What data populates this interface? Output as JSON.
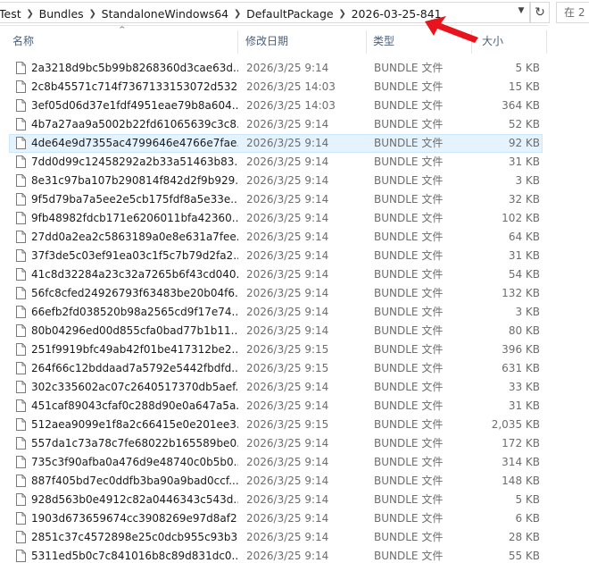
{
  "address": {
    "crumbs": [
      "Test",
      "Bundles",
      "StandaloneWindows64",
      "DefaultPackage",
      "2026-03-25-841"
    ],
    "search_placeholder": "在 2"
  },
  "columns": {
    "name": "名称",
    "date": "修改日期",
    "type": "类型",
    "size": "大小"
  },
  "files": [
    {
      "name": "2a3218d9bc5b99b8268360d3cae63d...",
      "date": "2026/3/25 9:14",
      "type": "BUNDLE 文件",
      "size": "5 KB"
    },
    {
      "name": "2c8b45571c714f7367133153072d532...",
      "date": "2026/3/25 14:03",
      "type": "BUNDLE 文件",
      "size": "15 KB"
    },
    {
      "name": "3ef05d06d37e1fdf4951eae79b8a604...",
      "date": "2026/3/25 14:03",
      "type": "BUNDLE 文件",
      "size": "364 KB"
    },
    {
      "name": "4b7a27aa9a5002b22fd61065639c3c8...",
      "date": "2026/3/25 9:14",
      "type": "BUNDLE 文件",
      "size": "52 KB"
    },
    {
      "name": "4de64e9d7355ac4799646e4766e7fae...",
      "date": "2026/3/25 9:14",
      "type": "BUNDLE 文件",
      "size": "92 KB"
    },
    {
      "name": "7dd0d99c12458292a2b33a51463b83...",
      "date": "2026/3/25 9:14",
      "type": "BUNDLE 文件",
      "size": "31 KB"
    },
    {
      "name": "8e31c97ba107b290814f842d2f9b929...",
      "date": "2026/3/25 9:14",
      "type": "BUNDLE 文件",
      "size": "3 KB"
    },
    {
      "name": "9f5d79ba7a5ee2e5cb175fdf8a5e33e...",
      "date": "2026/3/25 9:14",
      "type": "BUNDLE 文件",
      "size": "32 KB"
    },
    {
      "name": "9fb48982fdcb171e6206011bfa42360...",
      "date": "2026/3/25 9:14",
      "type": "BUNDLE 文件",
      "size": "102 KB"
    },
    {
      "name": "27dd0a2ea2c5863189a0e8e631a7fee...",
      "date": "2026/3/25 9:14",
      "type": "BUNDLE 文件",
      "size": "64 KB"
    },
    {
      "name": "37f3de5c03ef91ea03c1f5c7b79d2fa2...",
      "date": "2026/3/25 9:14",
      "type": "BUNDLE 文件",
      "size": "31 KB"
    },
    {
      "name": "41c8d32284a23c32a7265b6f43cd040...",
      "date": "2026/3/25 9:14",
      "type": "BUNDLE 文件",
      "size": "54 KB"
    },
    {
      "name": "56fc8cfed24926793f63483be20b04f6...",
      "date": "2026/3/25 9:14",
      "type": "BUNDLE 文件",
      "size": "132 KB"
    },
    {
      "name": "66efb2fd038520b98a2565cd9f17e74...",
      "date": "2026/3/25 9:14",
      "type": "BUNDLE 文件",
      "size": "3 KB"
    },
    {
      "name": "80b04296ed00d855cfa0bad77b1b11...",
      "date": "2026/3/25 9:14",
      "type": "BUNDLE 文件",
      "size": "80 KB"
    },
    {
      "name": "251f9919bfc49ab42f01be417312be2...",
      "date": "2026/3/25 9:15",
      "type": "BUNDLE 文件",
      "size": "396 KB"
    },
    {
      "name": "264f66c12bddaad7a5792e5442fbdfd...",
      "date": "2026/3/25 9:15",
      "type": "BUNDLE 文件",
      "size": "631 KB"
    },
    {
      "name": "302c335602ac07c2640517370db5aef...",
      "date": "2026/3/25 9:14",
      "type": "BUNDLE 文件",
      "size": "33 KB"
    },
    {
      "name": "451caf89043cfaf0c288d90e0a647a5a...",
      "date": "2026/3/25 9:14",
      "type": "BUNDLE 文件",
      "size": "31 KB"
    },
    {
      "name": "512aea9099e1f8a2c66415e0e201ee3...",
      "date": "2026/3/25 9:15",
      "type": "BUNDLE 文件",
      "size": "2,035 KB"
    },
    {
      "name": "557da1c73a78c7fe68022b165589be0...",
      "date": "2026/3/25 9:14",
      "type": "BUNDLE 文件",
      "size": "172 KB"
    },
    {
      "name": "735c3f90afba0a476d9e48740c0b5b0...",
      "date": "2026/3/25 9:14",
      "type": "BUNDLE 文件",
      "size": "314 KB"
    },
    {
      "name": "887f405bd7ec0ddfb3ba90a9bad0ccf...",
      "date": "2026/3/25 9:14",
      "type": "BUNDLE 文件",
      "size": "148 KB"
    },
    {
      "name": "928d563b0e4912c82a0446343c543d...",
      "date": "2026/3/25 9:14",
      "type": "BUNDLE 文件",
      "size": "5 KB"
    },
    {
      "name": "1903d673659674cc3908269e97d8af2...",
      "date": "2026/3/25 9:14",
      "type": "BUNDLE 文件",
      "size": "6 KB"
    },
    {
      "name": "2851c37c4572898e25c0dcb955c93b3...",
      "date": "2026/3/25 9:14",
      "type": "BUNDLE 文件",
      "size": "28 KB"
    },
    {
      "name": "5311ed5b0c7c841016b8c89d831dc0...",
      "date": "2026/3/25 9:14",
      "type": "BUNDLE 文件",
      "size": "55 KB"
    }
  ],
  "selected_index": 4,
  "colors": {
    "selected_bg": "#e5f3ff",
    "selected_border": "#cce8ff",
    "header_text": "#4c607a",
    "arrow": "#e8131c"
  },
  "icons": {
    "breadcrumb_separator": "chevron-right-icon",
    "dropdown": "chevron-down-icon",
    "refresh": "refresh-icon",
    "file": "file-icon",
    "annotation": "red-arrow-icon"
  }
}
